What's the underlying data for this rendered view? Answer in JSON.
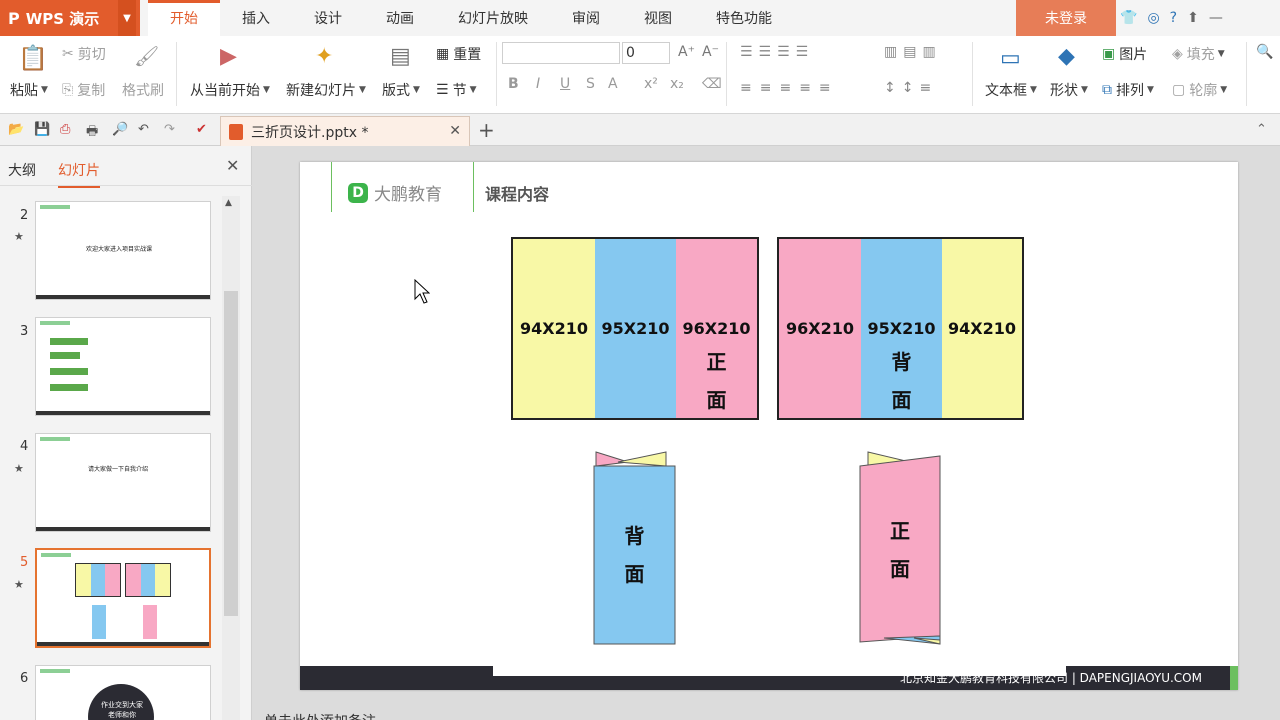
{
  "app": {
    "name": "WPS 演示",
    "logo": "P"
  },
  "menu_tabs": [
    "开始",
    "插入",
    "设计",
    "动画",
    "幻灯片放映",
    "审阅",
    "视图",
    "特色功能"
  ],
  "login": "未登录",
  "ribbon": {
    "cut": "剪切",
    "copy": "复制",
    "paste": "粘贴",
    "format_painter": "格式刷",
    "from_current": "从当前开始",
    "new_slide": "新建幻灯片",
    "layout": "版式",
    "reset": "重置",
    "section": "节",
    "font_size": "0",
    "textbox": "文本框",
    "shape": "形状",
    "arrange": "排列",
    "picture": "图片",
    "fill": "填充",
    "outline": "轮廓"
  },
  "doc_tab": {
    "title": "三折页设计.pptx *"
  },
  "left_pane": {
    "tabs": [
      "大纲",
      "幻灯片"
    ],
    "slides": [
      {
        "num": "2",
        "text": "欢迎大家进入项目实战课"
      },
      {
        "num": "3",
        "text": ""
      },
      {
        "num": "4",
        "text": "请大家做一下自我介绍"
      },
      {
        "num": "5",
        "text": ""
      },
      {
        "num": "6",
        "text": "作业交到大家老师和你"
      }
    ]
  },
  "slide": {
    "brand": "大鹏教育",
    "section": "课程内容",
    "back_panel": {
      "segments": [
        {
          "label": "94X210",
          "color": "#f8f8a6"
        },
        {
          "label": "95X210",
          "color": "#85c8f0"
        },
        {
          "label": "96X210",
          "color": "#f8a8c4",
          "caption": "正\n面"
        }
      ]
    },
    "front_panel": {
      "segments": [
        {
          "label": "96X210",
          "color": "#f8a8c4"
        },
        {
          "label": "95X210",
          "color": "#85c8f0",
          "caption": "背\n面"
        },
        {
          "label": "94X210",
          "color": "#f8f8a6"
        }
      ]
    },
    "folded_back": "背\n面",
    "folded_front": "正\n面",
    "footer": "北京知金大鹏教育科技有限公司   |   DAPENGJIAOYU.COM"
  },
  "notes": "单击此处添加备注"
}
